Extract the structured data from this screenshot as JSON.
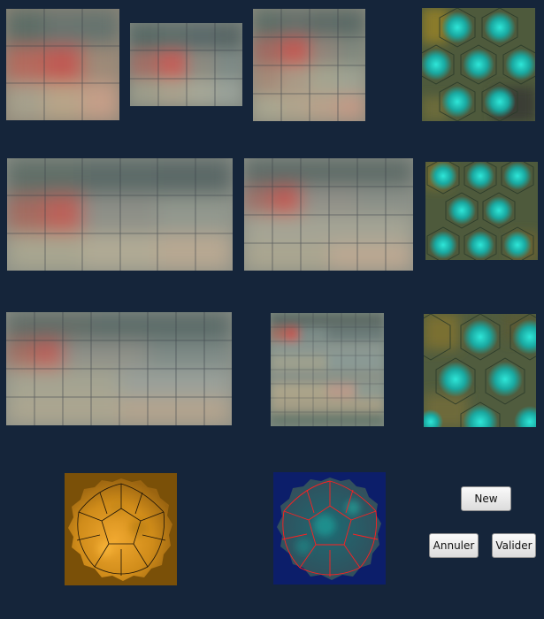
{
  "buttons": {
    "new_label": "New",
    "cancel_label": "Annuler",
    "validate_label": "Valider"
  },
  "colors": {
    "background": "#15253a",
    "square_palette": [
      "#b45a55",
      "#8c8c80",
      "#a8a890",
      "#c29482",
      "#7d8a88",
      "#b2b29a"
    ],
    "hex_center": "#2ee6d8",
    "hex_edge": "#8a7a2a",
    "amber_panel": "#7a5008",
    "blue_panel": "#0c1e6a",
    "grid_red": "#ff2020"
  }
}
